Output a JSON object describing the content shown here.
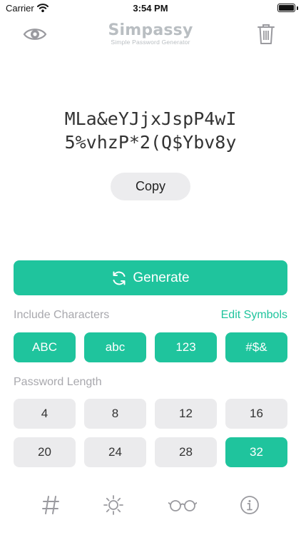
{
  "status_bar": {
    "carrier": "Carrier",
    "time": "3:54 PM"
  },
  "header": {
    "title": "Simpassy",
    "subtitle": "Simple Password Generator"
  },
  "password": {
    "line1": "MLa&eYJjxJspP4wI",
    "line2": "5%vhzP*2(Q$Ybv8y"
  },
  "copy_label": "Copy",
  "generate_label": "Generate",
  "include": {
    "label": "Include Characters",
    "edit_label": "Edit Symbols",
    "options": [
      {
        "label": "ABC",
        "selected": true
      },
      {
        "label": "abc",
        "selected": true
      },
      {
        "label": "123",
        "selected": true
      },
      {
        "label": "#$&",
        "selected": true
      }
    ]
  },
  "length": {
    "label": "Password Length",
    "options": [
      {
        "label": "4",
        "selected": false
      },
      {
        "label": "8",
        "selected": false
      },
      {
        "label": "12",
        "selected": false
      },
      {
        "label": "16",
        "selected": false
      },
      {
        "label": "20",
        "selected": false
      },
      {
        "label": "24",
        "selected": false
      },
      {
        "label": "28",
        "selected": false
      },
      {
        "label": "32",
        "selected": true
      }
    ]
  },
  "tabs": [
    {
      "icon": "hash-icon"
    },
    {
      "icon": "sun-icon"
    },
    {
      "icon": "glasses-icon"
    },
    {
      "icon": "info-icon"
    }
  ],
  "colors": {
    "accent": "#1fc49d",
    "chip_off": "#ebebed",
    "muted": "#a8a8ad"
  }
}
